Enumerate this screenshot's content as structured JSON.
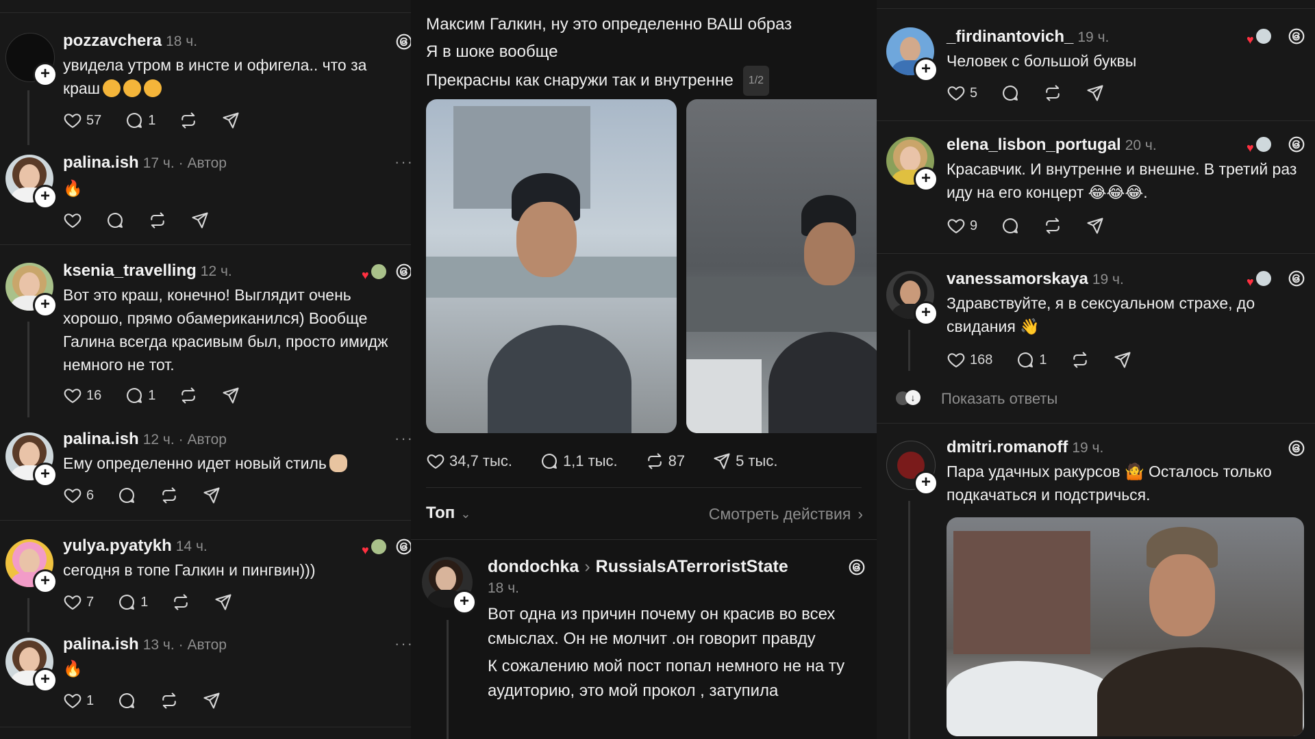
{
  "left": {
    "comments": [
      {
        "user": "pozzavchera",
        "time": "18 ч.",
        "author": "",
        "text_main": "увидела утром в инсте и офигела.. что за",
        "text_line2": "краш",
        "likes": "57",
        "replies": "1",
        "has_thread_icon": true
      },
      {
        "user": "palina.ish",
        "time": "17 ч.",
        "author": "· Автор",
        "text_main": "🔥",
        "likes": "",
        "replies": ""
      },
      {
        "user": "ksenia_travelling",
        "time": "12 ч.",
        "author": "",
        "text_main": "Вот это краш, конечно! Выглядит очень хорошо, прямо обамериканился) Вообще Галина всегда красивым был, просто имидж немного не тот.",
        "likes": "16",
        "replies": "1"
      },
      {
        "user": "palina.ish",
        "time": "12 ч.",
        "author": "· Автор",
        "text_main": "Ему определенно идет новый стиль",
        "likes": "6",
        "replies": ""
      },
      {
        "user": "yulya.pyatykh",
        "time": "14 ч.",
        "author": "",
        "text_main": "сегодня в топе Галкин и пингвин)))",
        "likes": "7",
        "replies": "1"
      },
      {
        "user": "palina.ish",
        "time": "13 ч.",
        "author": "· Автор",
        "text_main": "🔥",
        "likes": "1",
        "replies": ""
      }
    ]
  },
  "mid": {
    "post_lines": [
      "Максим Галкин, ну это определенно ВАШ образ",
      "Я в шоке вообще",
      "Прекрасны как снаружи так и внутренне"
    ],
    "image_counter": "1/2",
    "stats": {
      "likes": "34,7 тыс.",
      "comments": "1,1 тыс.",
      "reposts": "87",
      "shares": "5 тыс."
    },
    "sort_label": "Топ",
    "activity_link": "Смотреть действия",
    "reply": {
      "user": "dondochka",
      "target": "RussiaIsATerroristState",
      "time": "18 ч.",
      "text1": "Вот одна из причин почему он красив во всех смыслах. Он не молчит .он говорит правду",
      "text2": "К сожалению мой пост попал немного не на ту аудиторию, это мой прокол , затупила"
    }
  },
  "right": {
    "comments": [
      {
        "user": "_firdinantovich_",
        "time": "19 ч.",
        "text": "Человек с большой буквы",
        "likes": "5",
        "replies": ""
      },
      {
        "user": "elena_lisbon_portugal",
        "time": "20 ч.",
        "text": "Красавчик. И внутренне и внешне. В третий раз иду на его концерт 😂😂😂.",
        "likes": "9",
        "replies": ""
      },
      {
        "user": "vanessamorskaya",
        "time": "19 ч.",
        "text": "Здравствуйте, я в сексуальном страхе, до свидания 👋",
        "likes": "168",
        "replies": "1"
      },
      {
        "user": "dmitri.romanoff",
        "time": "19 ч.",
        "text": "Пара удачных ракурсов 🤷 Осталось только подкачаться и подстричься.",
        "likes": "",
        "replies": ""
      }
    ],
    "show_replies": "Показать ответы"
  },
  "colors": {
    "bg": "#181818",
    "text": "#f3f3f3",
    "muted": "#8e8e8e",
    "heart": "#ff3040"
  },
  "icons": [
    "heart-icon",
    "comment-icon",
    "repost-icon",
    "share-icon",
    "threads-logo-icon",
    "plus-icon",
    "more-icon",
    "chevron-down-icon",
    "chevron-right-icon"
  ]
}
